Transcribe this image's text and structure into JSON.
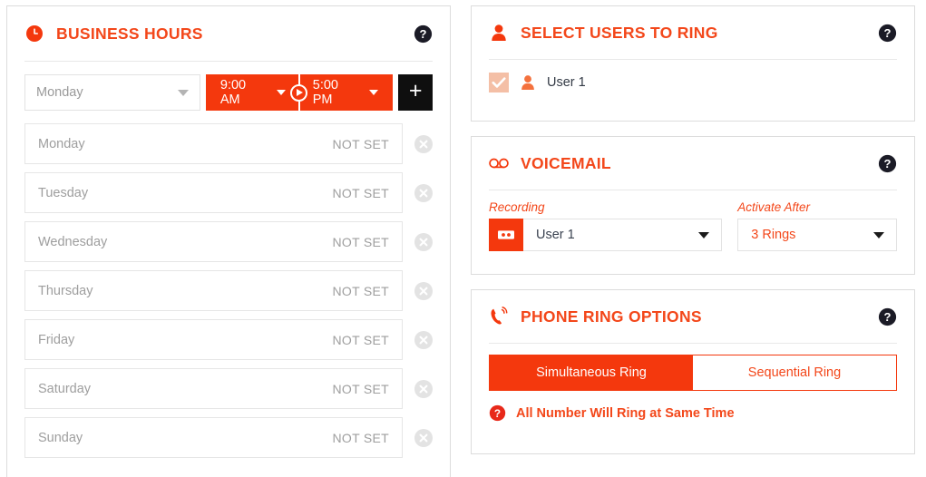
{
  "colors": {
    "accent": "#f3471a",
    "accent_fill": "#f4380d",
    "dark": "#1b1b1b",
    "muted": "#9e9e9e",
    "checkbox_fill": "#f4bfa6"
  },
  "business_hours": {
    "title": "BUSINESS HOURS",
    "clock_icon": "clock-icon",
    "help_icon": "help-icon",
    "day_select": {
      "value": "Monday",
      "caret_icon": "chevron-down-icon"
    },
    "time_start": {
      "value": "9:00 AM",
      "caret_icon": "chevron-down-icon"
    },
    "time_separator_icon": "play-circle-icon",
    "time_end": {
      "value": "5:00 PM",
      "caret_icon": "chevron-down-icon"
    },
    "add_button": {
      "label": "+",
      "icon": "plus-icon"
    },
    "status_not_set": "NOT SET",
    "delete_icon": "circle-x-icon",
    "days": [
      {
        "name": "Monday",
        "status": "NOT SET"
      },
      {
        "name": "Tuesday",
        "status": "NOT SET"
      },
      {
        "name": "Wednesday",
        "status": "NOT SET"
      },
      {
        "name": "Thursday",
        "status": "NOT SET"
      },
      {
        "name": "Friday",
        "status": "NOT SET"
      },
      {
        "name": "Saturday",
        "status": "NOT SET"
      },
      {
        "name": "Sunday",
        "status": "NOT SET"
      }
    ]
  },
  "select_users": {
    "title": "SELECT USERS TO RING",
    "person_icon": "person-icon",
    "help_icon": "help-icon",
    "users": [
      {
        "name": "User 1",
        "checked": true,
        "check_icon": "check-icon",
        "avatar_icon": "person-icon"
      }
    ]
  },
  "voicemail": {
    "title": "VOICEMAIL",
    "tape_icon": "voicemail-tape-icon",
    "help_icon": "help-icon",
    "recording": {
      "label": "Recording",
      "value": "User 1",
      "badge_icon": "cassette-icon",
      "caret_icon": "chevron-down-icon"
    },
    "activate_after": {
      "label": "Activate After",
      "value": "3 Rings",
      "caret_icon": "chevron-down-icon"
    }
  },
  "phone_ring_options": {
    "title": "PHONE RING OPTIONS",
    "phone_ring_icon": "phone-ring-icon",
    "help_icon": "help-icon",
    "tabs": [
      {
        "label": "Simultaneous Ring",
        "active": true
      },
      {
        "label": "Sequential Ring",
        "active": false
      }
    ],
    "note": {
      "icon": "help-circle-icon",
      "text": "All Number Will Ring at Same Time"
    }
  }
}
